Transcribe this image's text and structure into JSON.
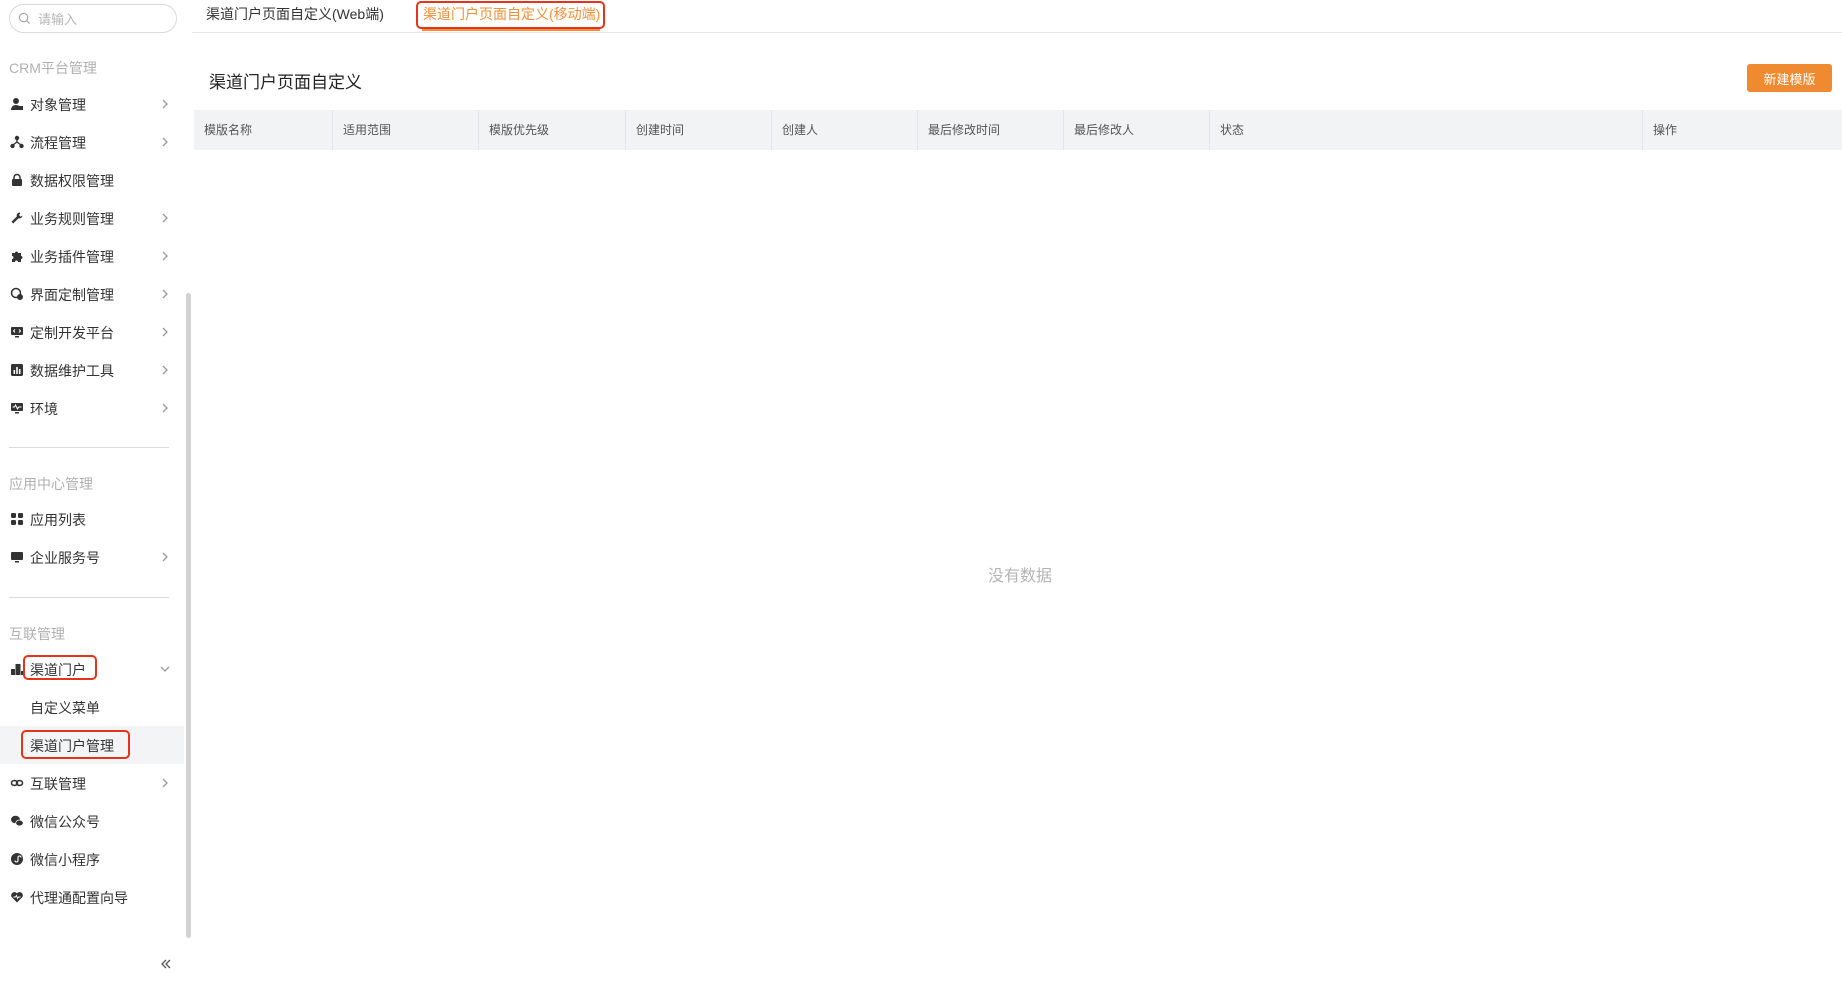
{
  "sidebar": {
    "search_placeholder": "请输入",
    "section_crm": "CRM平台管理",
    "section_app": "应用中心管理",
    "section_interconnect": "互联管理",
    "items": [
      {
        "label": "对象管理",
        "icon": "user-icon"
      },
      {
        "label": "流程管理",
        "icon": "flow-icon"
      },
      {
        "label": "数据权限管理",
        "icon": "lock-icon"
      },
      {
        "label": "业务规则管理",
        "icon": "wrench-icon"
      },
      {
        "label": "业务插件管理",
        "icon": "puzzle-icon"
      },
      {
        "label": "界面定制管理",
        "icon": "palette-icon"
      },
      {
        "label": "定制开发平台",
        "icon": "monitor-code-icon"
      },
      {
        "label": "数据维护工具",
        "icon": "chart-icon"
      },
      {
        "label": "环境",
        "icon": "monitor-pulse-icon"
      },
      {
        "label": "应用列表",
        "icon": "apps-grid-icon"
      },
      {
        "label": "企业服务号",
        "icon": "monitor-icon"
      },
      {
        "label": "渠道门户",
        "icon": "building-icon"
      },
      {
        "label": "自定义菜单",
        "icon": ""
      },
      {
        "label": "渠道门户管理",
        "icon": ""
      },
      {
        "label": "互联管理",
        "icon": "link-icon"
      },
      {
        "label": "微信公众号",
        "icon": "wechat-icon"
      },
      {
        "label": "微信小程序",
        "icon": "miniprogram-icon"
      },
      {
        "label": "代理通配置向导",
        "icon": "heart-icon"
      }
    ]
  },
  "tabs": [
    {
      "label": "渠道门户页面自定义(Web端)",
      "active": false
    },
    {
      "label": "渠道门户页面自定义(移动端)",
      "active": true
    }
  ],
  "main": {
    "title": "渠道门户页面自定义",
    "new_button": "新建模版",
    "columns": [
      "模版名称",
      "适用范围",
      "模版优先级",
      "创建时间",
      "创建人",
      "最后修改时间",
      "最后修改人",
      "状态",
      "操作"
    ],
    "empty_text": "没有数据"
  },
  "colors": {
    "accent": "#f08a31",
    "highlight": "#e5331c"
  }
}
